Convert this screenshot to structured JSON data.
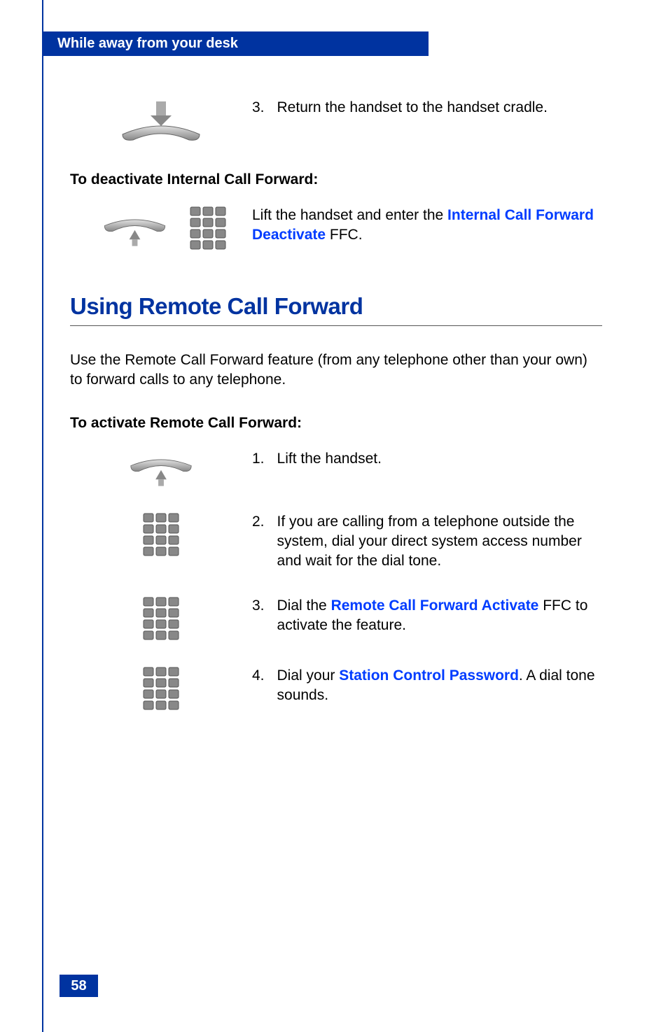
{
  "header": {
    "title": "While away from your desk"
  },
  "step_return": {
    "num": "3.",
    "text": "Return the handset to the handset cradle."
  },
  "deactivate_heading": "To deactivate Internal Call Forward:",
  "deactivate_step": {
    "text_before": "Lift the handset and enter the ",
    "link": "Internal Call Forward Deactivate",
    "text_after": " FFC."
  },
  "section_heading": "Using Remote Call Forward",
  "intro": "Use the Remote Call Forward feature (from any telephone other than your own) to forward calls to any telephone.",
  "activate_heading": "To activate Remote Call Forward:",
  "activate_steps": [
    {
      "num": "1.",
      "text": "Lift the handset."
    },
    {
      "num": "2.",
      "text": "If you are calling from a telephone outside the system, dial your direct system access number and wait for the dial tone."
    },
    {
      "num": "3.",
      "before": "Dial the ",
      "link": "Remote Call Forward Activate",
      "after": " FFC to activate the feature."
    },
    {
      "num": "4.",
      "before": "Dial your ",
      "link": "Station Control Password",
      "after": ". A dial tone sounds."
    }
  ],
  "page_number": "58"
}
